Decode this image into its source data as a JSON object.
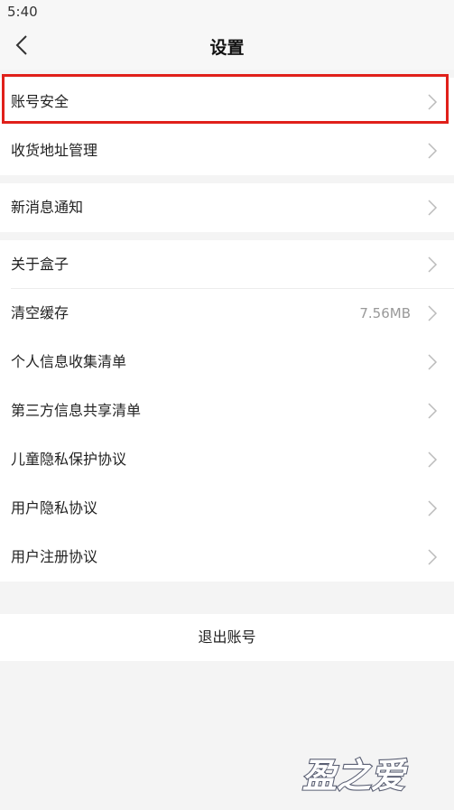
{
  "status_bar": {
    "time": "5:40"
  },
  "header": {
    "title": "设置",
    "back_icon": "chevron-left-icon"
  },
  "groups": [
    {
      "items": [
        {
          "label": "账号安全"
        },
        {
          "label": "收货地址管理"
        }
      ]
    },
    {
      "items": [
        {
          "label": "新消息通知"
        }
      ]
    },
    {
      "items": [
        {
          "label": "关于盒子"
        },
        {
          "label": "清空缓存",
          "value": "7.56MB"
        },
        {
          "label": "个人信息收集清单"
        },
        {
          "label": "第三方信息共享清单"
        },
        {
          "label": "儿童隐私保护协议"
        },
        {
          "label": "用户隐私协议"
        },
        {
          "label": "用户注册协议"
        }
      ]
    }
  ],
  "logout_label": "退出账号",
  "highlight_color": "#e0201a",
  "watermark": {
    "text": "盈之爱"
  }
}
